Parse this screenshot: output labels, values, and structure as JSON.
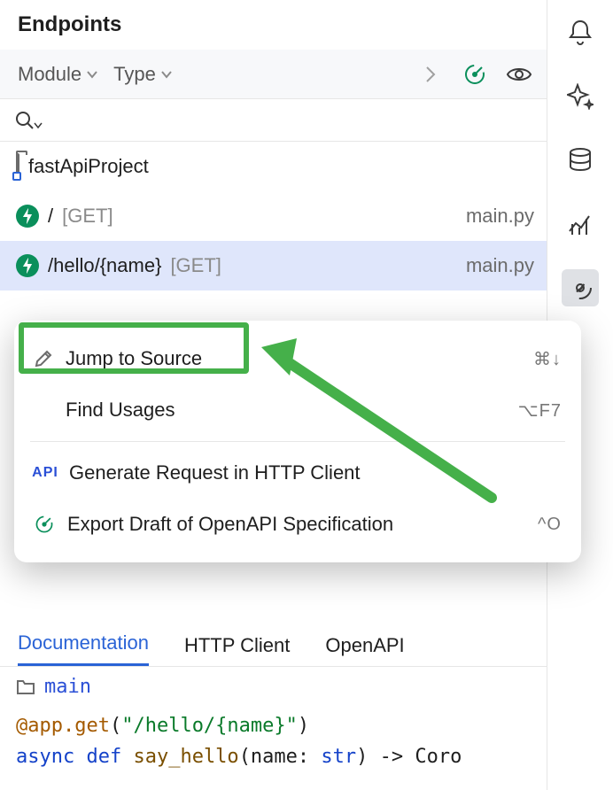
{
  "panel": {
    "title": "Endpoints"
  },
  "filters": {
    "module_label": "Module",
    "type_label": "Type"
  },
  "tree": {
    "project_name": "fastApiProject",
    "endpoints": [
      {
        "path": "/",
        "method": "[GET]",
        "file": "main.py"
      },
      {
        "path": "/hello/{name}",
        "method": "[GET]",
        "file": "main.py"
      }
    ]
  },
  "context_menu": {
    "items": [
      {
        "label": "Jump to Source",
        "shortcut": "⌘↓",
        "icon": "pencil"
      },
      {
        "label": "Find Usages",
        "shortcut": "⌥F7",
        "icon": ""
      },
      {
        "label": "Generate Request in HTTP Client",
        "shortcut": "",
        "icon": "api"
      },
      {
        "label": "Export Draft of OpenAPI Specification",
        "shortcut": "^O",
        "icon": "openapi"
      }
    ]
  },
  "tabs": {
    "items": [
      "Documentation",
      "HTTP Client",
      "OpenAPI"
    ],
    "active": 0
  },
  "preview": {
    "crumb": "main",
    "line1_deco": "@app.get",
    "line1_paren_open": "(",
    "line1_str": "\"/hello/{name}\"",
    "line1_paren_close": ")",
    "line2_async": "async ",
    "line2_def": "def ",
    "line2_name": "say_hello",
    "line2_params_open": "(name: ",
    "line2_type": "str",
    "line2_params_close": ") -> Coro"
  }
}
